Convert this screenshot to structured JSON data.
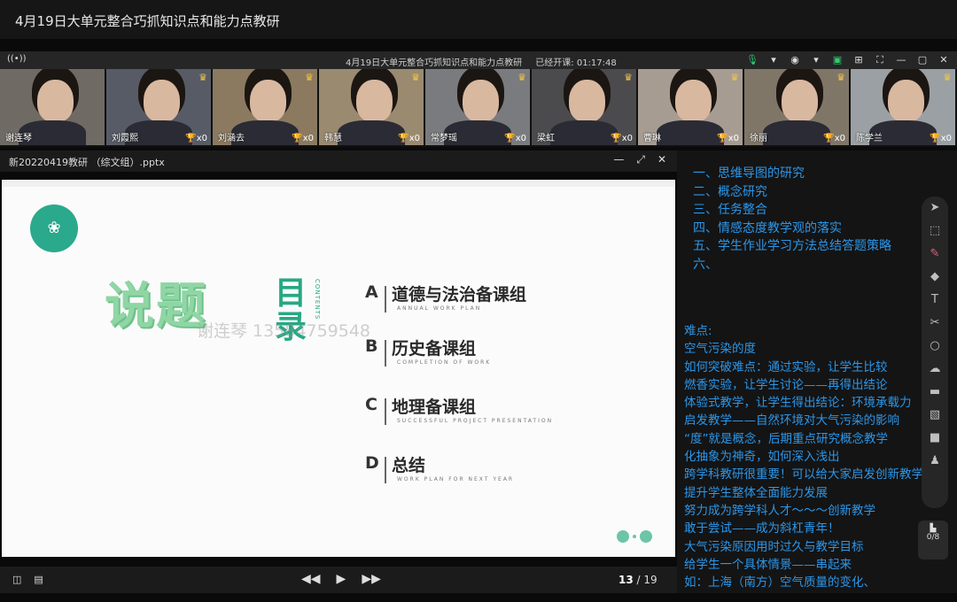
{
  "window_title": "4月19日大单元整合巧抓知识点和能力点教研",
  "meeting_bar": {
    "title": "4月19日大单元整合巧抓知识点和能力点教研",
    "elapsed_label": "已经开课: 01:17:48"
  },
  "participants": [
    {
      "name": "谢连琴",
      "trophy": "",
      "bg": "#6f6a63",
      "crown": ""
    },
    {
      "name": "刘霞熙",
      "trophy": "x0",
      "bg": "#575b66",
      "crown": "♛"
    },
    {
      "name": "刘涵去",
      "trophy": "x0",
      "bg": "#8b7a60",
      "crown": "♛"
    },
    {
      "name": "韩慧",
      "trophy": "x0",
      "bg": "#9a8a70",
      "crown": "♛"
    },
    {
      "name": "常梦瑶",
      "trophy": "x0",
      "bg": "#7a7b7e",
      "crown": "♛"
    },
    {
      "name": "梁虹",
      "trophy": "x0",
      "bg": "#4b4b4e",
      "crown": "♛"
    },
    {
      "name": "曹琳",
      "trophy": "x0",
      "bg": "#a79c92",
      "crown": "♛"
    },
    {
      "name": "徐丽",
      "trophy": "x0",
      "bg": "#807668",
      "crown": "♛"
    },
    {
      "name": "陈学兰",
      "trophy": "x0",
      "bg": "#9aa0a3",
      "crown": "♛"
    }
  ],
  "ppt": {
    "filename": "新20220419教研 （综文组）.pptx",
    "slide": {
      "shuoti": "说题",
      "mulu": "目录",
      "contents": "CONTENTS",
      "watermark": "谢连琴 13584759548",
      "items": [
        {
          "letter": "A",
          "title": "道德与法治备课组",
          "sub": "ANNUAL WORK PLAN"
        },
        {
          "letter": "B",
          "title": "历史备课组",
          "sub": "COMPLETION OF WORK"
        },
        {
          "letter": "C",
          "title": "地理备课组",
          "sub": "SUCCESSFUL PROJECT PRESENTATION"
        },
        {
          "letter": "D",
          "title": "总结",
          "sub": "WORK PLAN FOR NEXT YEAR"
        }
      ]
    },
    "page_current": "13",
    "page_total": "/ 19"
  },
  "notes": {
    "outline": [
      "一、思维导图的研究",
      "二、概念研究",
      "三、任务整合",
      "四、情感态度教学观的落实",
      "五、学生作业学习方法总结答题策略",
      "六、"
    ],
    "body": [
      "难点:",
      "空气污染的度",
      "如何突破难点：通过实验，让学生比较",
      "燃香实验，让学生讨论——再得出结论",
      "体验式教学，让学生得出结论：环境承载力",
      "启发教学——自然环境对大气污染的影响",
      "“度”就是概念，后期重点研究概念教学",
      "化抽象为神奇，如何深入浅出",
      "跨学科教研很重要！可以给大家启发创新教学",
      "提升学生整体全面能力发展",
      "努力成为跨学科人才～～～创新教学",
      "敢于尝试——成为斜杠青年！",
      "大气污染原因用时过久与教学目标",
      "给学生一个具体情景——串起来",
      "如：上海（南方）空气质量的变化、"
    ]
  },
  "toolbox": {
    "tools": [
      "cursor-icon",
      "select-icon",
      "pen-icon",
      "eraser-icon",
      "text-icon",
      "scissors-icon",
      "shape-icon",
      "cloud-icon",
      "save-icon",
      "image-icon",
      "camera-icon",
      "user-icon"
    ],
    "pager": "0/8"
  }
}
